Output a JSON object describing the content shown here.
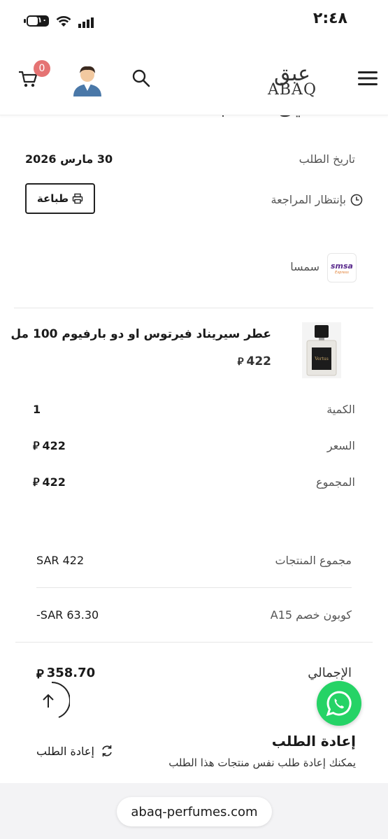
{
  "status_bar": {
    "time": "٢:٤٨",
    "battery": "١٠"
  },
  "header": {
    "logo_arabic": "عبق",
    "logo_english": "ABAQ",
    "cart_count": "0"
  },
  "order": {
    "partial_title": "تفاصيل الطلب",
    "date_label": "تاريخ الطلب",
    "date_value": "30 مارس 2026",
    "status": "بإنتظار المراجعة",
    "print_label": "طباعة",
    "shipping_company": "سمسا",
    "shipping_logo_text": "smsa",
    "shipping_logo_sub": "Express"
  },
  "product": {
    "name": "عطر سيريناد فيرتوس او دو بارفيوم 100 مل",
    "price": "422",
    "image_label": "Vertus",
    "quantity_label": "الكمية",
    "quantity_value": "1",
    "price_label": "السعر",
    "price_value": "422",
    "total_label": "المجموع",
    "total_value": "422"
  },
  "summary": {
    "products_total_label": "مجموع المنتجات",
    "products_total_value": "SAR 422",
    "coupon_label": "كوبون خصم A15",
    "coupon_value": "-SAR 63.30",
    "grand_total_label": "الإجمالي",
    "grand_total_value": "358.70"
  },
  "reorder": {
    "title": "إعادة الطلب",
    "subtitle": "يمكنك إعادة طلب نفس منتجات هذا الطلب",
    "button_label": "إعادة الطلب"
  },
  "browser": {
    "url": "abaq-perfumes.com"
  },
  "colors": {
    "badge": "#e57373",
    "whatsapp": "#25d366"
  }
}
